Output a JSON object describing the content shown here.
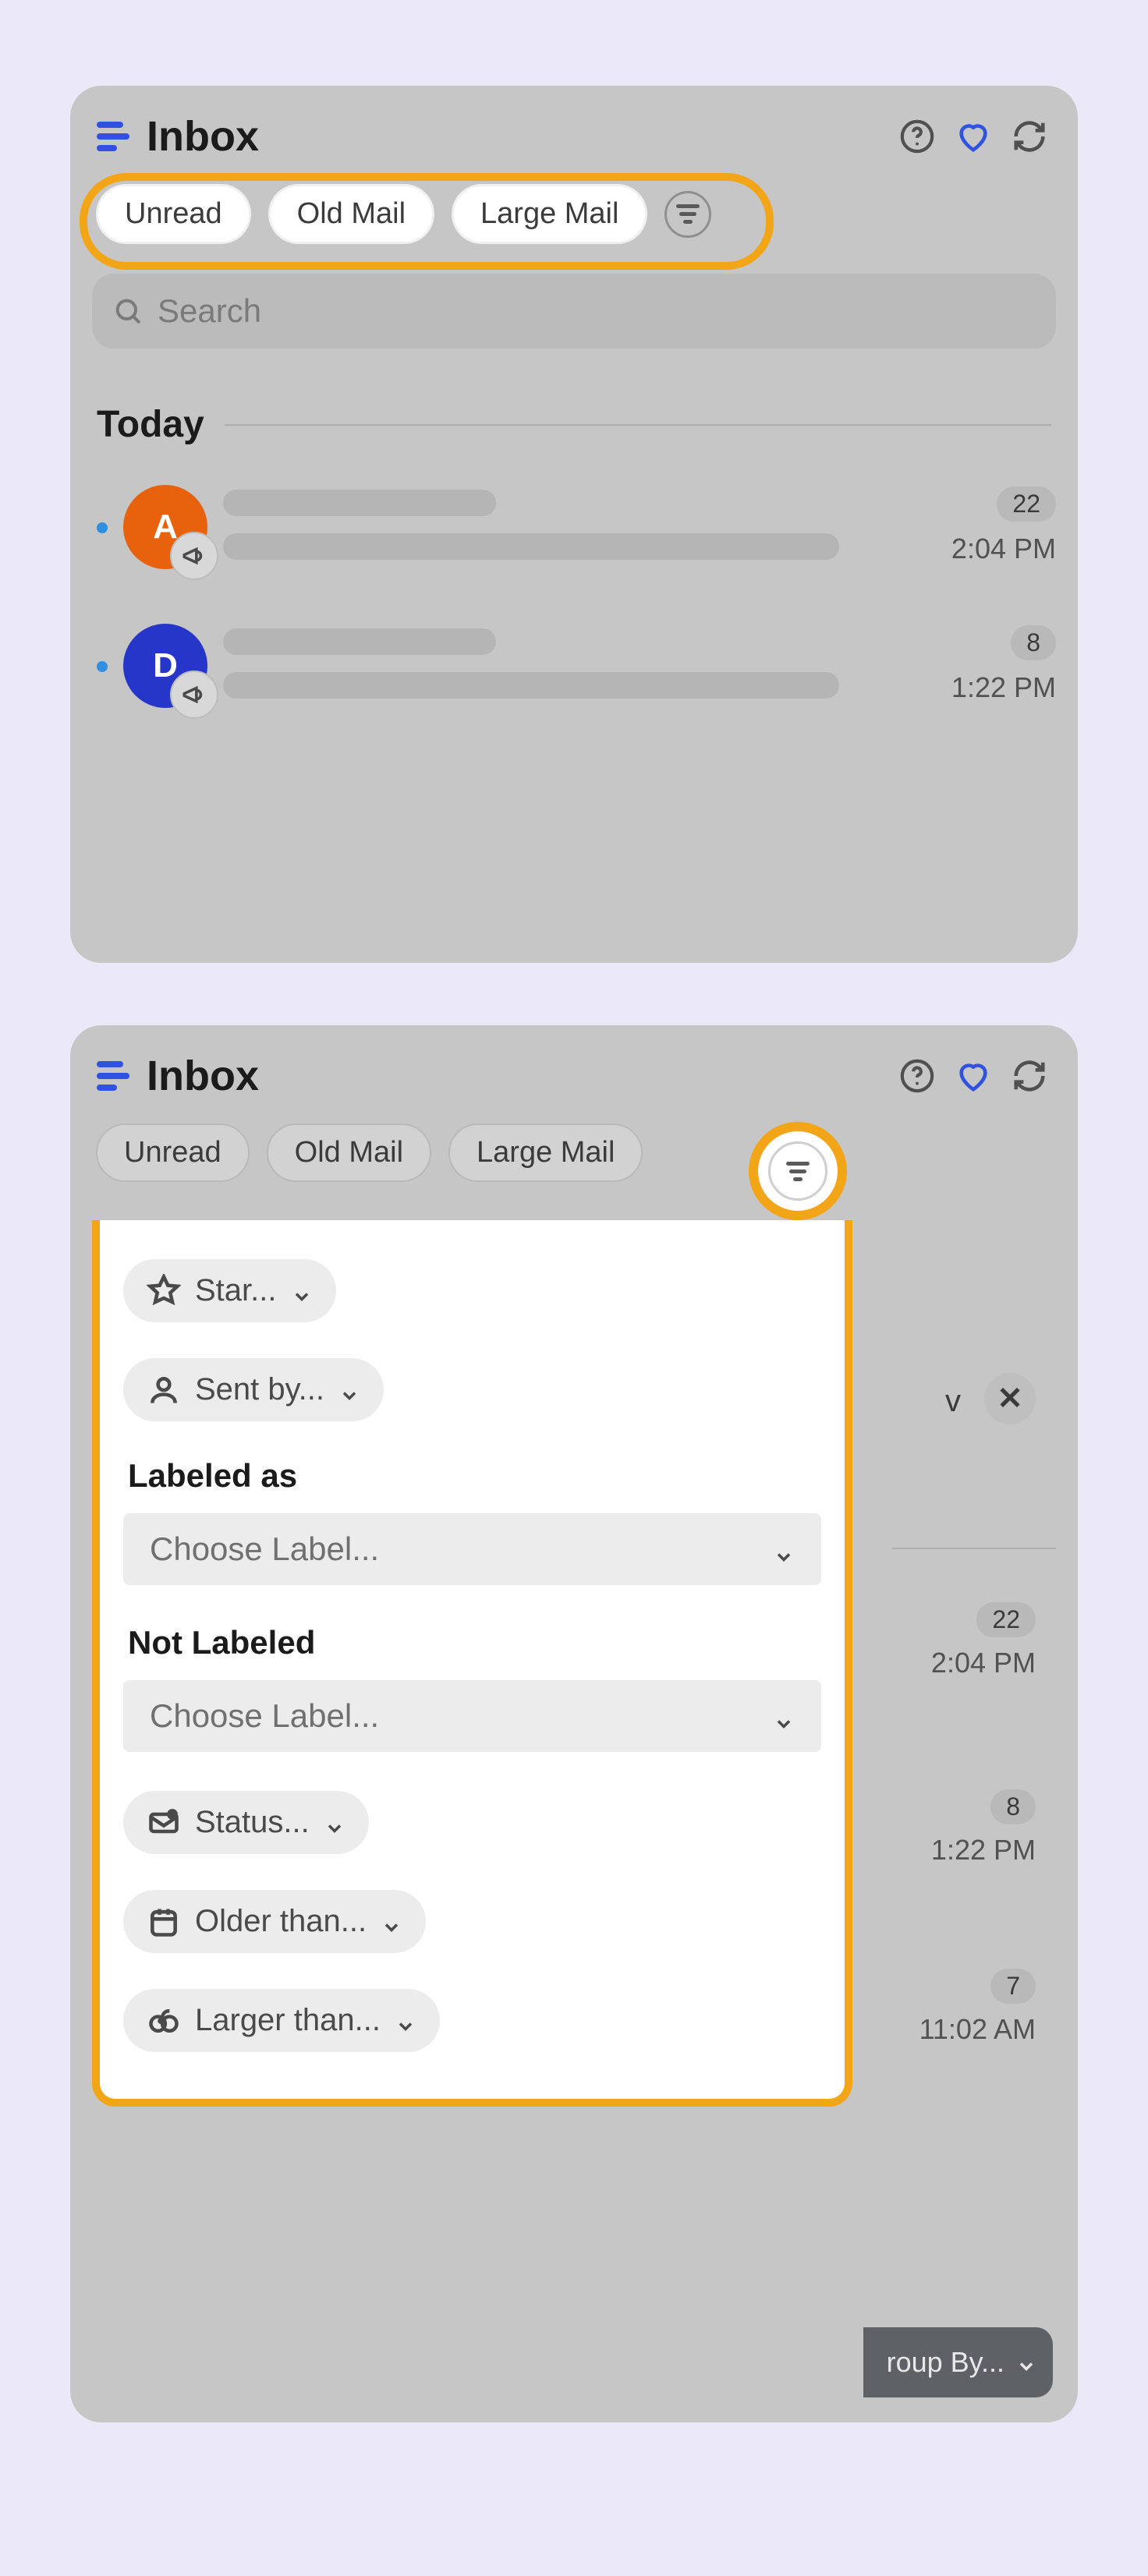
{
  "panel1": {
    "title": "Inbox",
    "chips": [
      "Unread",
      "Old Mail",
      "Large Mail"
    ],
    "search_placeholder": "Search",
    "section": "Today",
    "emails": [
      {
        "avatar_letter": "A",
        "avatar_color": "orange",
        "count": "22",
        "time": "2:04 PM"
      },
      {
        "avatar_letter": "D",
        "avatar_color": "blue",
        "count": "8",
        "time": "1:22 PM"
      }
    ]
  },
  "panel2": {
    "title": "Inbox",
    "chips": [
      "Unread",
      "Old Mail",
      "Large Mail"
    ],
    "bg_emails": [
      {
        "count": "22",
        "time": "2:04 PM"
      },
      {
        "count": "8",
        "time": "1:22 PM"
      },
      {
        "count": "7",
        "time": "11:02 AM"
      }
    ],
    "group_by": "roup By...",
    "popup": {
      "star": "Star...",
      "sent_by": "Sent by...",
      "labeled_as": "Labeled as",
      "not_labeled": "Not Labeled",
      "choose_label": "Choose Label...",
      "status": "Status...",
      "older_than": "Older than...",
      "larger_than": "Larger than..."
    }
  }
}
